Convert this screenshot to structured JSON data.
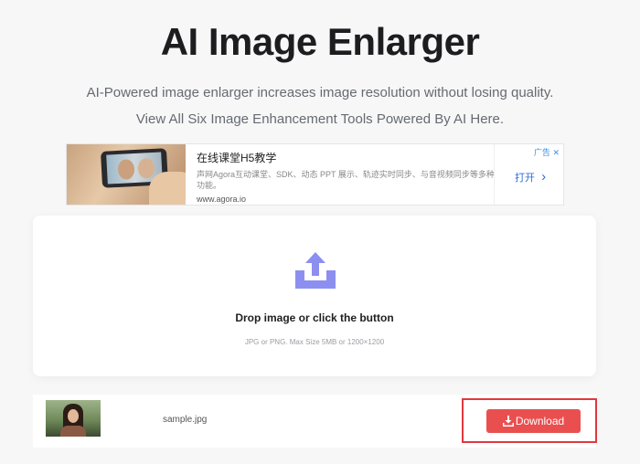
{
  "header": {
    "title": "AI Image Enlarger",
    "subtitle": "AI-Powered image enlarger increases image resolution without losing quality.",
    "tools_link": "View All Six Image Enhancement Tools Powered By AI Here."
  },
  "ad": {
    "headline": "在线课堂H5教学",
    "description": "声网Agora互动课堂、SDK、动态 PPT 展示、轨迹实时同步、与音视频同步等多种功能。",
    "url": "www.agora.io",
    "label": "广告",
    "open_button": "打开"
  },
  "dropzone": {
    "title": "Drop image or click the button",
    "hint": "JPG or PNG. Max Size 5MB or 1200×1200",
    "icon": "upload-icon",
    "icon_color": "#8c8ff0"
  },
  "file": {
    "name": "sample.jpg",
    "download_label": "Download",
    "download_color": "#ea4f4f"
  }
}
